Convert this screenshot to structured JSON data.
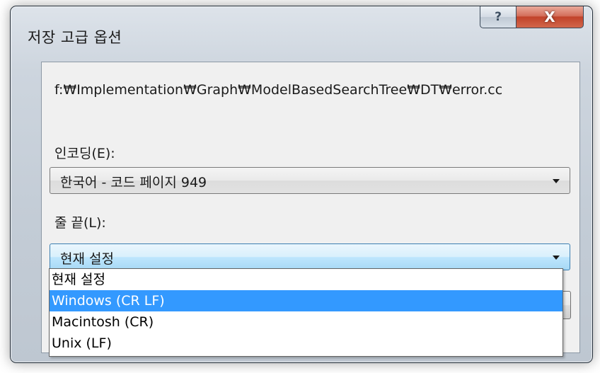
{
  "dialog": {
    "title": "저장 고급 옵션",
    "help_label": "?",
    "close_label": "X"
  },
  "file_path": "f:₩Implementation₩Graph₩ModelBasedSearchTree₩DT₩error.cc",
  "encoding": {
    "label": "인코딩(E):",
    "value": "한국어 - 코드 페이지 949"
  },
  "line_endings": {
    "label": "줄 끝(L):",
    "value": "현재 설정",
    "options": [
      "현재 설정",
      "Windows (CR LF)",
      "Macintosh (CR)",
      "Unix (LF)"
    ],
    "highlighted_index": 1
  }
}
